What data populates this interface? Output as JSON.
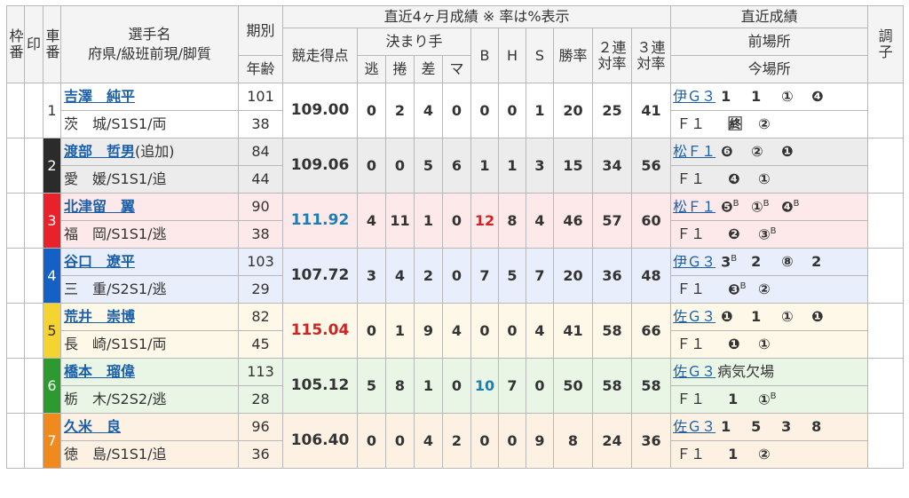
{
  "header": {
    "waku": "枠番",
    "shirushi": "印",
    "sha": "車番",
    "name_top": "選手名",
    "name_bottom": "府県/級班前現/脚質",
    "kibetsu": "期別",
    "nenrei": "年齢",
    "recent_title": "直近4ヶ月成績 ※ 率は%表示",
    "score": "競走得点",
    "kimarite": "決まり手",
    "nige": "逃",
    "makuri": "捲",
    "sashi": "差",
    "ma": "マ",
    "b": "B",
    "h": "H",
    "s": "S",
    "win_rate": "勝率",
    "rate2_top": "２連",
    "rate2_bottom": "対率",
    "rate3_top": "３連",
    "rate3_bottom": "対率",
    "latest_title": "直近成績",
    "prev_venue": "前場所",
    "cur_venue": "今場所",
    "condition": "調子"
  },
  "riders": [
    {
      "num": "1",
      "name": "吉澤　純平",
      "extra": "",
      "pref": "茨　城/S1S1/両",
      "term": "101",
      "age": "38",
      "score": "109.00",
      "score_color": "#333333",
      "nige": "0",
      "makuri": "2",
      "sashi": "4",
      "ma": "0",
      "b": "0",
      "h": "0",
      "s": "1",
      "win": "20",
      "r2": "25",
      "r3": "41",
      "prev_venue": "伊Ｇ３",
      "prev_results": [
        "1",
        "1",
        "①",
        "❹"
      ],
      "prev_sup": [
        "",
        "",
        "",
        ""
      ],
      "cur_venue": "Ｆ１",
      "cur_results": [
        "🈡",
        "②"
      ],
      "cur_sup": [
        "",
        ""
      ]
    },
    {
      "num": "2",
      "name": "渡部　哲男",
      "extra": "(追加)",
      "pref": "愛　媛/S1S1/追",
      "term": "84",
      "age": "44",
      "score": "109.06",
      "score_color": "#333333",
      "nige": "0",
      "makuri": "0",
      "sashi": "5",
      "ma": "6",
      "b": "1",
      "h": "1",
      "s": "3",
      "win": "15",
      "r2": "34",
      "r3": "56",
      "prev_venue": "松Ｆ１",
      "prev_results": [
        "❻",
        "②",
        "❶"
      ],
      "prev_sup": [
        "",
        "",
        ""
      ],
      "cur_venue": "Ｆ１",
      "cur_results": [
        "❹",
        "①"
      ],
      "cur_sup": [
        "",
        ""
      ]
    },
    {
      "num": "3",
      "name": "北津留　翼",
      "extra": "",
      "pref": "福　岡/S1S1/逃",
      "term": "90",
      "age": "38",
      "score": "111.92",
      "score_color": "#1a7fb5",
      "nige": "4",
      "makuri": "11",
      "sashi": "1",
      "ma": "0",
      "b": "12",
      "b_color": "#d22222",
      "h": "8",
      "s": "4",
      "win": "46",
      "r2": "57",
      "r3": "60",
      "prev_venue": "松Ｆ１",
      "prev_results": [
        "❺",
        "①",
        "❹"
      ],
      "prev_sup": [
        "B",
        "B",
        "B"
      ],
      "cur_venue": "Ｆ１",
      "cur_results": [
        "❷",
        "③"
      ],
      "cur_sup": [
        "",
        "B"
      ]
    },
    {
      "num": "4",
      "name": "谷口　遼平",
      "extra": "",
      "pref": "三　重/S2S1/逃",
      "term": "103",
      "age": "29",
      "score": "107.72",
      "score_color": "#333333",
      "nige": "3",
      "makuri": "4",
      "sashi": "2",
      "ma": "0",
      "b": "7",
      "h": "5",
      "s": "7",
      "win": "20",
      "r2": "36",
      "r3": "48",
      "prev_venue": "伊Ｇ３",
      "prev_results": [
        "3",
        "2",
        "⑧",
        "2"
      ],
      "prev_sup": [
        "B",
        "",
        "",
        ""
      ],
      "cur_venue": "Ｆ１",
      "cur_results": [
        "❸",
        "②"
      ],
      "cur_sup": [
        "B",
        ""
      ]
    },
    {
      "num": "5",
      "name": "荒井　崇博",
      "extra": "",
      "pref": "長　崎/S1S1/両",
      "term": "82",
      "age": "45",
      "score": "115.04",
      "score_color": "#d22222",
      "nige": "0",
      "makuri": "1",
      "sashi": "9",
      "ma": "4",
      "b": "0",
      "h": "0",
      "s": "4",
      "win": "41",
      "r2": "58",
      "r3": "66",
      "prev_venue": "佐Ｇ３",
      "prev_results": [
        "❶",
        "1",
        "①",
        "❶"
      ],
      "prev_sup": [
        "",
        "",
        "",
        ""
      ],
      "cur_venue": "Ｆ１",
      "cur_results": [
        "❶",
        "①"
      ],
      "cur_sup": [
        "",
        ""
      ]
    },
    {
      "num": "6",
      "name": "橋本　瑠偉",
      "extra": "",
      "pref": "栃　木/S2S2/逃",
      "term": "113",
      "age": "28",
      "score": "105.12",
      "score_color": "#333333",
      "nige": "5",
      "makuri": "8",
      "sashi": "1",
      "ma": "0",
      "b": "10",
      "b_color": "#1a7fb5",
      "h": "7",
      "s": "0",
      "win": "50",
      "r2": "58",
      "r3": "58",
      "prev_venue": "佐Ｇ３",
      "prev_text": "病気欠場",
      "prev_results": [],
      "prev_sup": [],
      "cur_venue": "Ｆ１",
      "cur_results": [
        "1",
        "①"
      ],
      "cur_sup": [
        "",
        "B"
      ]
    },
    {
      "num": "7",
      "name": "久米　良",
      "extra": "",
      "pref": "徳　島/S1S1/追",
      "term": "96",
      "age": "36",
      "score": "106.40",
      "score_color": "#333333",
      "nige": "0",
      "makuri": "0",
      "sashi": "4",
      "ma": "2",
      "b": "0",
      "h": "0",
      "s": "9",
      "win": "8",
      "r2": "24",
      "r3": "36",
      "prev_venue": "佐Ｇ３",
      "prev_results": [
        "1",
        "5",
        "3",
        "8"
      ],
      "prev_sup": [
        "",
        "",
        "",
        ""
      ],
      "cur_venue": "Ｆ１",
      "cur_results": [
        "1",
        "②"
      ],
      "cur_sup": [
        "",
        ""
      ]
    }
  ]
}
